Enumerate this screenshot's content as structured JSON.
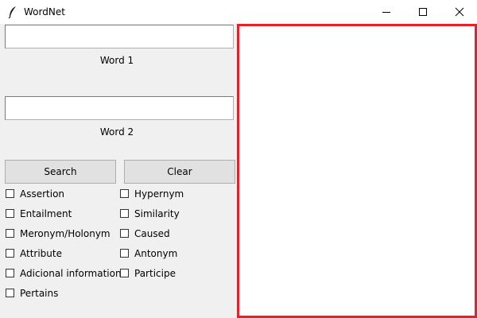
{
  "window": {
    "title": "WordNet",
    "app_icon": "feather-icon",
    "controls": [
      "minimize-icon",
      "maximize-icon",
      "close-icon"
    ]
  },
  "form": {
    "word1": {
      "value": "",
      "label": "Word 1"
    },
    "word2": {
      "value": "",
      "label": "Word 2"
    },
    "search_label": "Search",
    "clear_label": "Clear"
  },
  "options": {
    "left": [
      {
        "label": "Assertion",
        "checked": false
      },
      {
        "label": "Entailment",
        "checked": false
      },
      {
        "label": "Meronym/Holonym",
        "checked": false
      },
      {
        "label": "Attribute",
        "checked": false
      },
      {
        "label": "Adicional information",
        "checked": false
      },
      {
        "label": "Pertains",
        "checked": false
      }
    ],
    "right": [
      {
        "label": "Hypernym",
        "checked": false
      },
      {
        "label": "Similarity",
        "checked": false
      },
      {
        "label": "Caused",
        "checked": false
      },
      {
        "label": "Antonym",
        "checked": false
      },
      {
        "label": "Participe",
        "checked": false
      }
    ]
  },
  "result_panel": {
    "border_color": "#e8202a"
  }
}
